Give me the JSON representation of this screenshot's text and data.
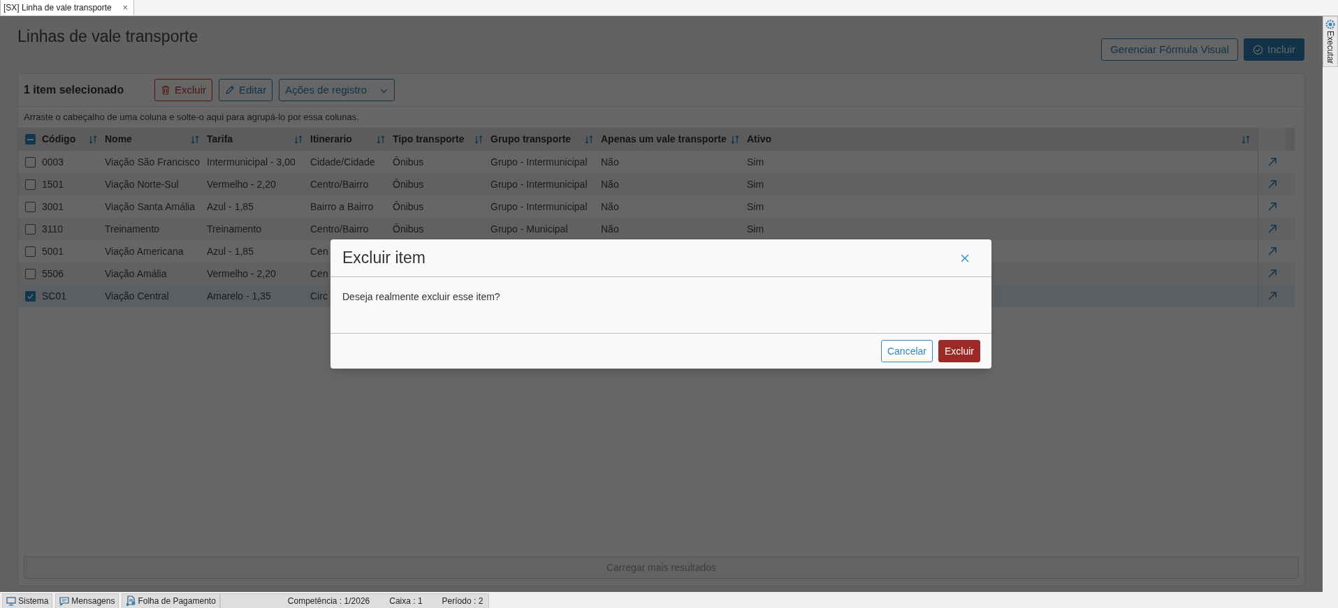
{
  "tab": {
    "title": "[SX] Linha de vale transporte",
    "close": "×"
  },
  "page": {
    "title": "Linhas de vale transporte",
    "buttons": [
      {
        "label": "Gerenciar Fórmula Visual",
        "kind": "outline"
      },
      {
        "label": "Incluir",
        "kind": "primary"
      }
    ]
  },
  "toolbar": {
    "selection": "1 item selecionado",
    "buttons": [
      {
        "label": "Excluir",
        "kind": "delete"
      },
      {
        "label": "Editar",
        "kind": "edit"
      },
      {
        "label": "Ações de registro",
        "kind": "menu"
      }
    ]
  },
  "group_hint": "Arraste o cabeçalho de uma coluna e solte-o aqui para agrupá-lo por essa colunas.",
  "table": {
    "header_checkbox": {
      "indeterminate": true
    },
    "columns": [
      "Código",
      "Nome",
      "Tarifa",
      "Itinerario",
      "Tipo transporte",
      "Grupo transporte",
      "Apenas um vale transporte",
      "Ativo"
    ],
    "rows": [
      {
        "selected": false,
        "cells": [
          "0003",
          "Viação São Francisco",
          "Intermunicipal - 3,00",
          "Cidade/Cidade",
          "Ônibus",
          "Grupo - Intermunicipal",
          "Não",
          "Sim"
        ]
      },
      {
        "selected": false,
        "cells": [
          "1501",
          "Viação Norte-Sul",
          "Vermelho - 2,20",
          "Centro/Bairro",
          "Ônibus",
          "Grupo - Intermunicipal",
          "Não",
          "Sim"
        ]
      },
      {
        "selected": false,
        "cells": [
          "3001",
          "Viação Santa Amália",
          "Azul - 1,85",
          "Bairro a Bairro",
          "Ônibus",
          "Grupo - Intermunicipal",
          "Não",
          "Sim"
        ]
      },
      {
        "selected": false,
        "cells": [
          "3110",
          "Treinamento",
          "Treinamento",
          "Centro/Bairro",
          "Ônibus",
          "Grupo - Municipal",
          "Não",
          "Sim"
        ]
      },
      {
        "selected": false,
        "cells": [
          "5001",
          "Viação Americana",
          "Azul - 1,85",
          "Cen"
        ]
      },
      {
        "selected": false,
        "cells": [
          "5506",
          "Viação Amália",
          "Vermelho - 2,20",
          "Cen"
        ]
      },
      {
        "selected": true,
        "cells": [
          "SC01",
          "Viação Central",
          "Amarelo - 1,35",
          "Circ"
        ]
      }
    ]
  },
  "load_more": "Carregar mais resultados",
  "dialog": {
    "title": "Excluir item",
    "message": "Deseja realmente excluir esse item?",
    "buttons": [
      {
        "label": "Cancelar",
        "kind": "outline"
      },
      {
        "label": "Excluir",
        "kind": "danger"
      }
    ]
  },
  "side_panel": {
    "label": "Executar"
  },
  "status_bar": [
    {
      "label": "Sistema",
      "kind": "monitor"
    },
    {
      "label": "Mensagens",
      "kind": "chat"
    },
    {
      "label": "Folha de Pagamento",
      "kind": "document"
    },
    {
      "label": "Competência : 1/2026",
      "kind": "text"
    },
    {
      "label": "Caixa : 1",
      "kind": "text"
    },
    {
      "label": "Período : 2",
      "kind": "text"
    }
  ]
}
